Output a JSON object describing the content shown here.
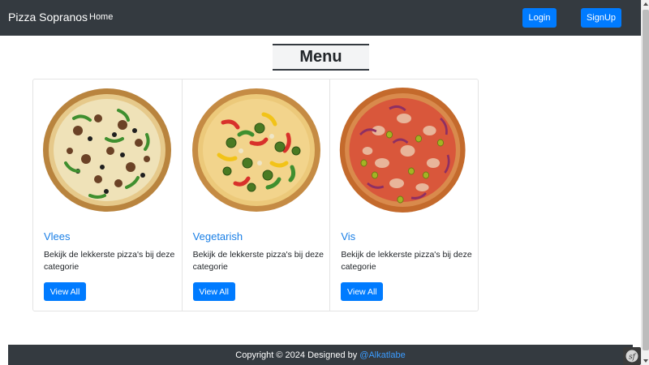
{
  "navbar": {
    "brand": "Pizza Sopranos",
    "home_link": "Home",
    "login_label": "Login",
    "signup_label": "SignUp"
  },
  "main": {
    "title": "Menu",
    "cards": [
      {
        "title": "Vlees",
        "text": "Bekijk de lekkerste pizza's bij deze categorie",
        "button": "View All",
        "image": "meat-pizza"
      },
      {
        "title": "Vegetarish",
        "text": "Bekijk de lekkerste pizza's bij deze categorie",
        "button": "View All",
        "image": "vegetarian-pizza"
      },
      {
        "title": "Vis",
        "text": "Bekijk de lekkerste pizza's bij deze categorie",
        "button": "View All",
        "image": "tuna-pizza"
      }
    ]
  },
  "footer": {
    "text": "Copyright © 2024 Designed by ",
    "author_link": "@Alkatlabe"
  },
  "colors": {
    "navbar_bg": "#343a40",
    "primary": "#007bff",
    "card_title": "#1a7fe6"
  }
}
